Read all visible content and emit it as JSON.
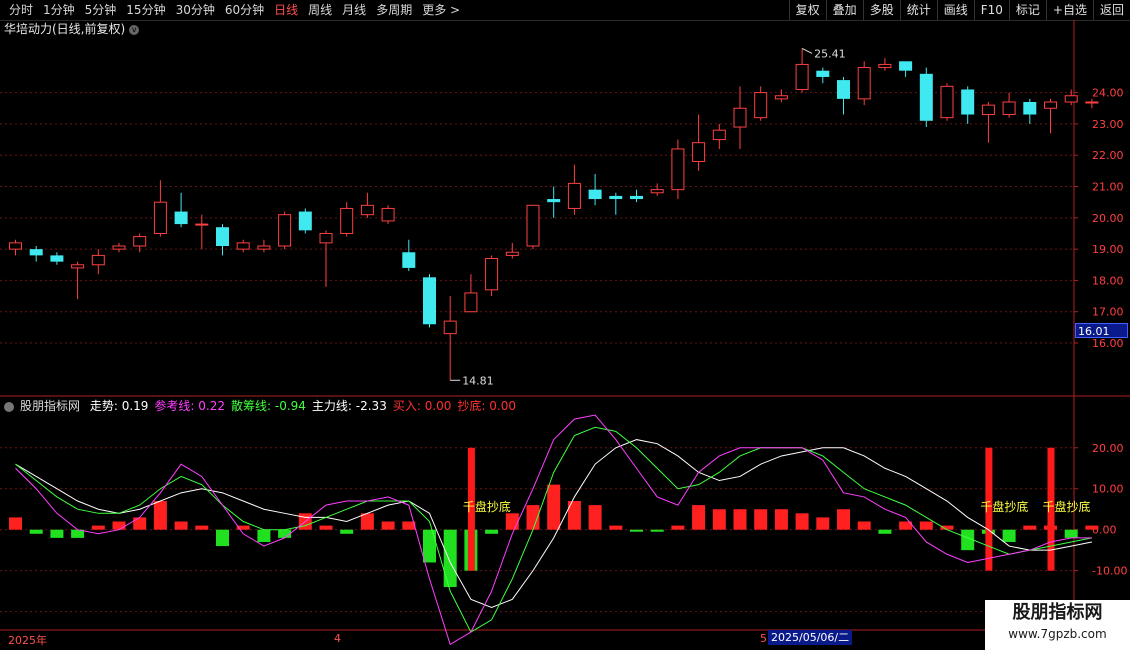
{
  "toolbar": {
    "left_items": [
      "分时",
      "1分钟",
      "5分钟",
      "15分钟",
      "30分钟",
      "60分钟",
      "日线",
      "周线",
      "月线",
      "多周期",
      "更多 >"
    ],
    "active_index": 6,
    "right_items": [
      "复权",
      "叠加",
      "多股",
      "统计",
      "画线",
      "F10",
      "标记",
      "+自选",
      "返回"
    ]
  },
  "main_title": "华培动力(日线,前复权)",
  "price_axis": [
    "24.00",
    "23.00",
    "22.00",
    "21.00",
    "20.00",
    "19.00",
    "18.00",
    "17.00",
    "16.00"
  ],
  "current_price": "16.01",
  "high_label": "25.41",
  "low_label": "14.81",
  "indicator": {
    "name": "股朋指标网",
    "items": [
      {
        "label": "走势: 0.19",
        "color": "#ffffff"
      },
      {
        "label": "参考线: 0.22",
        "color": "#ff40ff"
      },
      {
        "label": "散筹线: -0.94",
        "color": "#40ff40"
      },
      {
        "label": "主力线: -2.33",
        "color": "#ffffff"
      },
      {
        "label": "买入: 0.00",
        "color": "#ff3030"
      },
      {
        "label": "抄底: 0.00",
        "color": "#ff3030"
      }
    ],
    "axis": [
      "20.00",
      "10.00",
      "0.00",
      "-10.00",
      "-20.00"
    ],
    "signal_text": "千盘抄底"
  },
  "dates": {
    "year": "2025年",
    "m4": "4",
    "m5": "5",
    "cursor_date": "2025/05/06/二"
  },
  "logo": {
    "line1": "股朋指标网",
    "line2": "www.7gpzb.com"
  },
  "colors": {
    "up": "#ff4040",
    "down": "#40e8f0",
    "bg": "#000000"
  },
  "chart_data": {
    "type": "candlestick",
    "price_ylim": [
      14.5,
      26.0
    ],
    "candles": [
      {
        "o": 19.0,
        "c": 19.2,
        "h": 19.3,
        "l": 18.8
      },
      {
        "o": 19.0,
        "c": 18.8,
        "h": 19.1,
        "l": 18.6
      },
      {
        "o": 18.8,
        "c": 18.6,
        "h": 18.9,
        "l": 18.5
      },
      {
        "o": 18.4,
        "c": 18.5,
        "h": 18.6,
        "l": 17.4
      },
      {
        "o": 18.5,
        "c": 18.8,
        "h": 19.0,
        "l": 18.2
      },
      {
        "o": 19.0,
        "c": 19.1,
        "h": 19.2,
        "l": 18.9
      },
      {
        "o": 19.1,
        "c": 19.4,
        "h": 19.5,
        "l": 18.9
      },
      {
        "o": 19.5,
        "c": 20.5,
        "h": 21.2,
        "l": 19.4
      },
      {
        "o": 20.2,
        "c": 19.8,
        "h": 20.8,
        "l": 19.7
      },
      {
        "o": 19.8,
        "c": 19.8,
        "h": 20.1,
        "l": 19.0
      },
      {
        "o": 19.7,
        "c": 19.1,
        "h": 19.8,
        "l": 18.8
      },
      {
        "o": 19.0,
        "c": 19.2,
        "h": 19.3,
        "l": 18.9
      },
      {
        "o": 19.0,
        "c": 19.1,
        "h": 19.3,
        "l": 18.9
      },
      {
        "o": 19.1,
        "c": 20.1,
        "h": 20.2,
        "l": 19.0
      },
      {
        "o": 20.2,
        "c": 19.6,
        "h": 20.3,
        "l": 19.5
      },
      {
        "o": 19.2,
        "c": 19.5,
        "h": 19.6,
        "l": 17.8
      },
      {
        "o": 19.5,
        "c": 20.3,
        "h": 20.5,
        "l": 19.4
      },
      {
        "o": 20.1,
        "c": 20.4,
        "h": 20.8,
        "l": 20.0
      },
      {
        "o": 19.9,
        "c": 20.3,
        "h": 20.4,
        "l": 19.8
      },
      {
        "o": 18.9,
        "c": 18.4,
        "h": 19.3,
        "l": 18.3
      },
      {
        "o": 18.1,
        "c": 16.6,
        "h": 18.2,
        "l": 16.5
      },
      {
        "o": 16.3,
        "c": 16.7,
        "h": 17.5,
        "l": 14.81
      },
      {
        "o": 17.0,
        "c": 17.6,
        "h": 18.2,
        "l": 17.0
      },
      {
        "o": 17.7,
        "c": 18.7,
        "h": 18.8,
        "l": 17.5
      },
      {
        "o": 18.8,
        "c": 18.9,
        "h": 19.2,
        "l": 18.7
      },
      {
        "o": 19.1,
        "c": 20.4,
        "h": 20.4,
        "l": 19.0
      },
      {
        "o": 20.6,
        "c": 20.5,
        "h": 21.0,
        "l": 20.0
      },
      {
        "o": 20.3,
        "c": 21.1,
        "h": 21.7,
        "l": 20.1
      },
      {
        "o": 20.9,
        "c": 20.6,
        "h": 21.4,
        "l": 20.4
      },
      {
        "o": 20.7,
        "c": 20.6,
        "h": 20.8,
        "l": 20.1
      },
      {
        "o": 20.7,
        "c": 20.6,
        "h": 20.9,
        "l": 20.5
      },
      {
        "o": 20.8,
        "c": 20.9,
        "h": 21.1,
        "l": 20.7
      },
      {
        "o": 20.9,
        "c": 22.2,
        "h": 22.5,
        "l": 20.6
      },
      {
        "o": 21.8,
        "c": 22.4,
        "h": 23.3,
        "l": 21.5
      },
      {
        "o": 22.5,
        "c": 22.8,
        "h": 23.0,
        "l": 22.2
      },
      {
        "o": 22.9,
        "c": 23.5,
        "h": 24.2,
        "l": 22.2
      },
      {
        "o": 23.2,
        "c": 24.0,
        "h": 24.2,
        "l": 23.1
      },
      {
        "o": 23.8,
        "c": 23.9,
        "h": 24.1,
        "l": 23.7
      },
      {
        "o": 24.1,
        "c": 24.9,
        "h": 25.41,
        "l": 24.0
      },
      {
        "o": 24.7,
        "c": 24.5,
        "h": 24.8,
        "l": 24.3
      },
      {
        "o": 24.4,
        "c": 23.8,
        "h": 24.5,
        "l": 23.3
      },
      {
        "o": 23.8,
        "c": 24.8,
        "h": 25.0,
        "l": 23.6
      },
      {
        "o": 24.8,
        "c": 24.9,
        "h": 25.1,
        "l": 24.7
      },
      {
        "o": 25.0,
        "c": 24.7,
        "h": 25.0,
        "l": 24.5
      },
      {
        "o": 24.6,
        "c": 23.1,
        "h": 24.8,
        "l": 22.9
      },
      {
        "o": 23.2,
        "c": 24.2,
        "h": 24.3,
        "l": 23.1
      },
      {
        "o": 24.1,
        "c": 23.3,
        "h": 24.2,
        "l": 23.0
      },
      {
        "o": 23.3,
        "c": 23.6,
        "h": 23.7,
        "l": 22.4
      },
      {
        "o": 23.3,
        "c": 23.7,
        "h": 24.0,
        "l": 23.2
      },
      {
        "o": 23.7,
        "c": 23.3,
        "h": 23.8,
        "l": 23.0
      },
      {
        "o": 23.5,
        "c": 23.7,
        "h": 23.8,
        "l": 22.7
      },
      {
        "o": 23.7,
        "c": 23.9,
        "h": 24.1,
        "l": 23.6
      },
      {
        "o": 23.7,
        "c": 23.7,
        "h": 23.8,
        "l": 23.5
      }
    ],
    "ind_ylim": [
      -24,
      28
    ],
    "hist": [
      3,
      -1,
      -2,
      -2,
      1,
      2,
      3,
      7,
      2,
      1,
      -4,
      1,
      -3,
      -2,
      4,
      1,
      -1,
      4,
      2,
      2,
      -8,
      -14,
      -10,
      -1,
      4,
      6,
      11,
      7,
      6,
      1,
      -0.5,
      -0.5,
      1,
      6,
      5,
      5,
      5,
      5,
      4,
      3,
      5,
      2,
      -1,
      2,
      2,
      1,
      -5,
      -1,
      -3,
      1,
      1,
      -2,
      1
    ],
    "signals": [
      {
        "index": 22,
        "top": 20,
        "bottom": -10
      },
      {
        "index": 47,
        "top": 20,
        "bottom": -10
      },
      {
        "index": 50,
        "top": 20,
        "bottom": -10
      }
    ],
    "series": [
      {
        "name": "走势",
        "color": "#ffffff",
        "values": [
          16,
          13,
          10,
          7,
          5,
          4,
          5,
          7,
          9,
          10,
          9,
          7,
          5,
          4,
          3,
          3,
          2,
          4,
          6,
          7,
          4,
          -8,
          -17,
          -19,
          -17,
          -10,
          -2,
          8,
          16,
          20,
          22,
          21,
          18,
          14,
          12,
          13,
          16,
          18,
          19,
          20,
          20,
          18,
          15,
          13,
          10,
          7,
          3,
          0,
          -4,
          -5,
          -5,
          -4,
          -3
        ]
      },
      {
        "name": "参考线",
        "color": "#40ff40",
        "values": [
          16,
          12,
          8,
          5,
          4,
          4,
          6,
          10,
          13,
          11,
          6,
          2,
          0,
          0,
          1,
          3,
          5,
          7,
          7,
          7,
          2,
          -15,
          -25,
          -22,
          -12,
          0,
          14,
          23,
          25,
          24,
          20,
          15,
          10,
          11,
          14,
          18,
          20,
          20,
          20,
          18,
          14,
          10,
          8,
          6,
          3,
          0,
          -2,
          -4,
          -6,
          -5,
          -4,
          -3,
          -2
        ]
      },
      {
        "name": "主力线",
        "color": "#ff40ff",
        "values": [
          15,
          10,
          4,
          0,
          -1,
          0,
          3,
          9,
          16,
          13,
          6,
          -1,
          -4,
          -2,
          2,
          6,
          7,
          7,
          8,
          6,
          -12,
          -28,
          -25,
          -15,
          -1,
          10,
          22,
          27,
          28,
          22,
          15,
          8,
          6,
          14,
          18,
          20,
          20,
          20,
          20,
          17,
          9,
          8,
          5,
          3,
          -3,
          -6,
          -8,
          -7,
          -6,
          -5,
          -3,
          -2,
          -2
        ]
      }
    ]
  }
}
